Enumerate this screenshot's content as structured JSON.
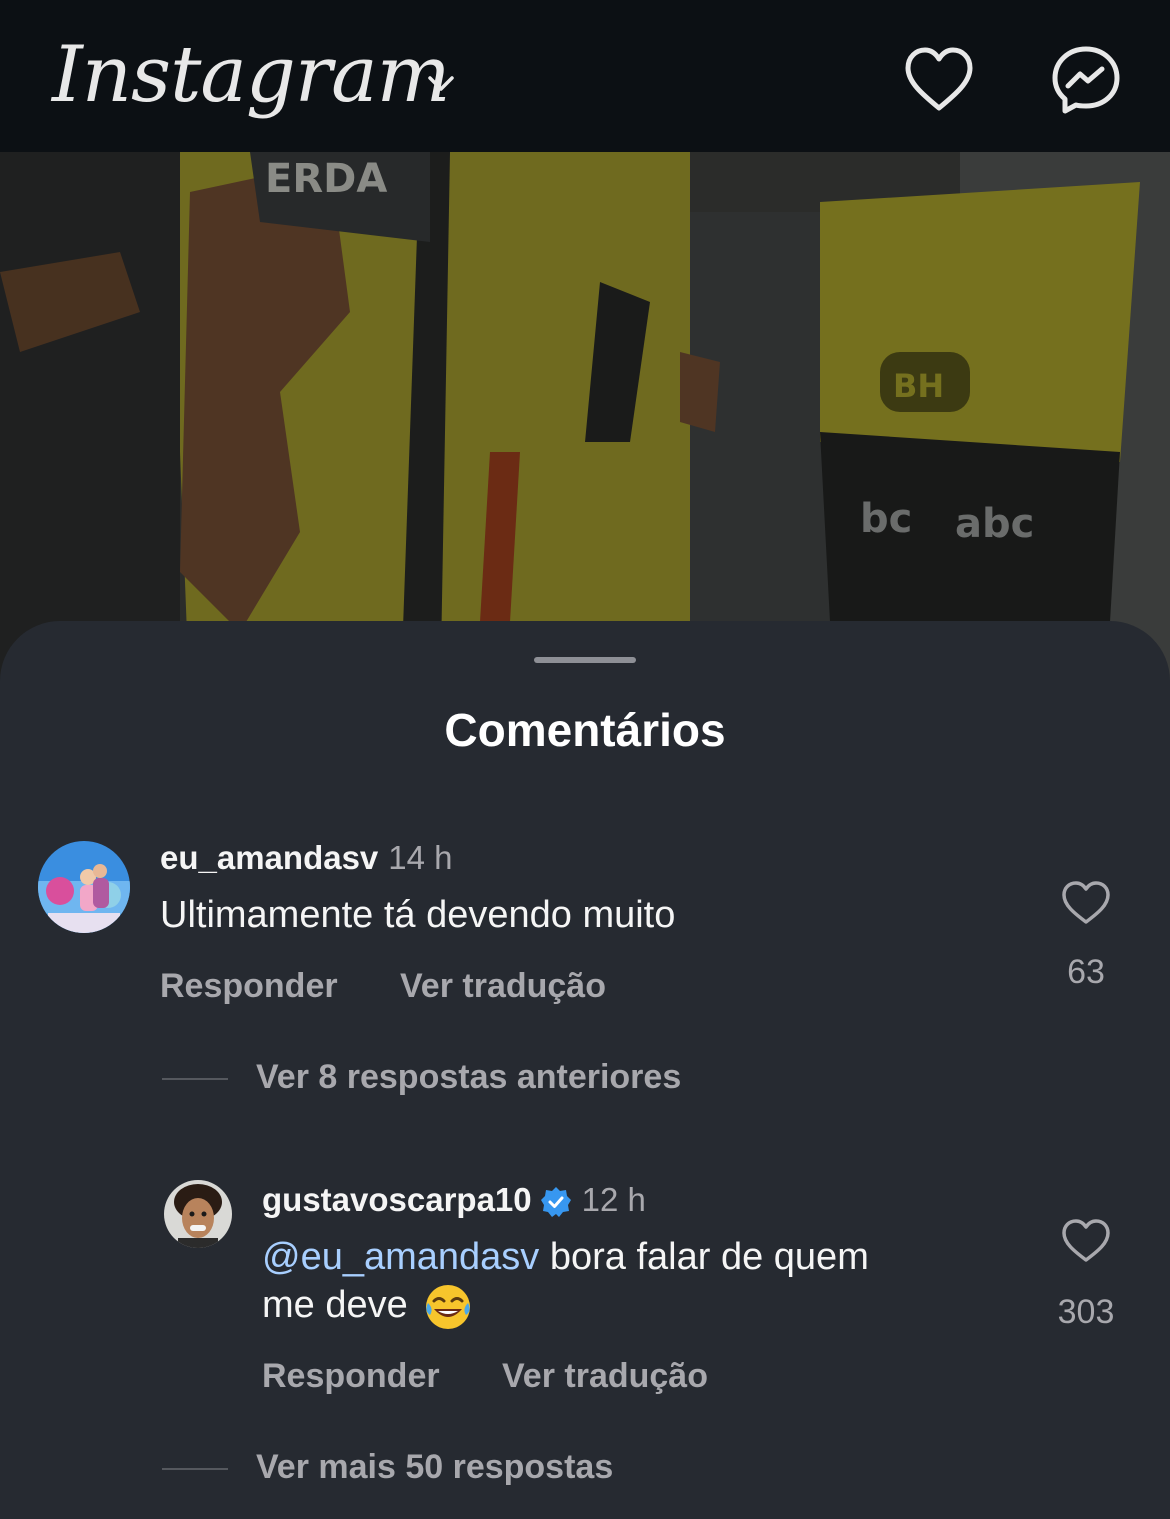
{
  "header": {
    "logo": "Instagram",
    "icons": [
      "chevron-down-icon",
      "heart-icon",
      "messenger-icon"
    ]
  },
  "sheet": {
    "title": "Comentários"
  },
  "comments": [
    {
      "username": "eu_amandasv",
      "time": "14 h",
      "text": "Ultimamente tá devendo muito",
      "reply_label": "Responder",
      "translate_label": "Ver tradução",
      "likes": "63"
    }
  ],
  "replies_previous": "Ver 8 respostas anteriores",
  "reply": {
    "username": "gustavoscarpa10",
    "verified": true,
    "time": "12 h",
    "mention": "@eu_amandasv",
    "text_line1": " bora falar de quem",
    "text_line2": "me deve",
    "emoji": "😂",
    "reply_label": "Responder",
    "translate_label": "Ver tradução",
    "likes": "303"
  },
  "replies_more": "Ver mais 50 respostas",
  "colors": {
    "background": "#0c1014",
    "sheet": "#262a31",
    "muted_text": "#a8a8ad",
    "mention": "#a8cfff",
    "verified": "#3797f0"
  }
}
